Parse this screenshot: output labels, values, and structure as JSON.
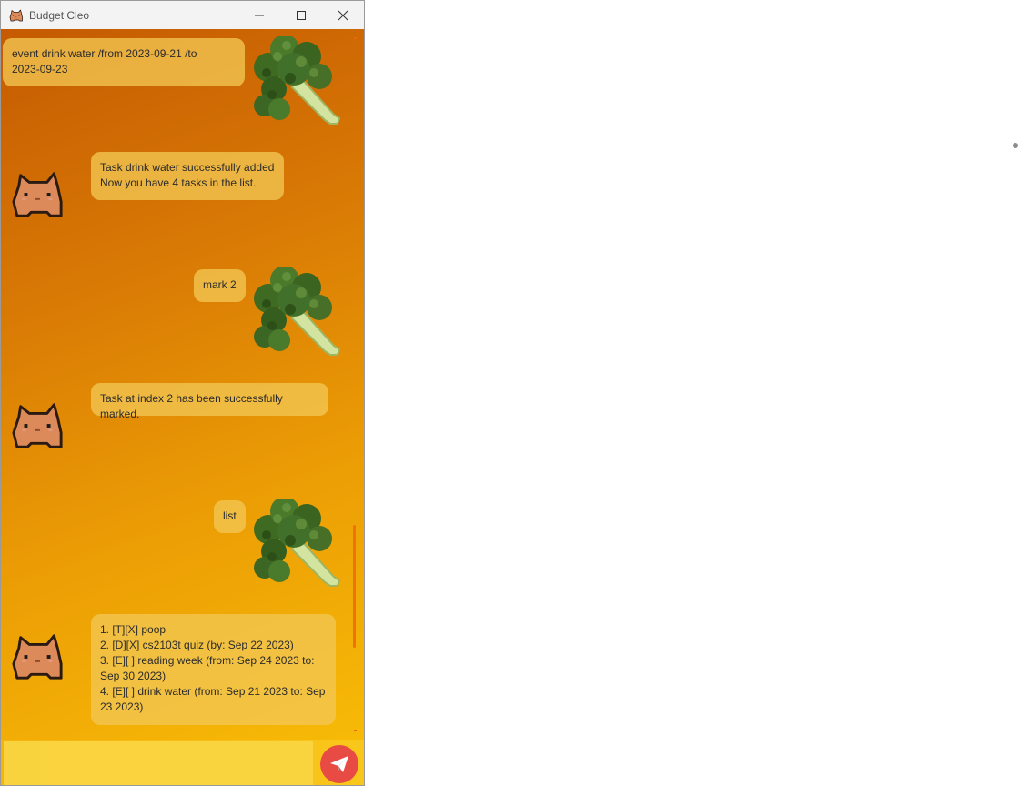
{
  "window": {
    "title": "Budget Cleo",
    "icons": {
      "app": "cat-app-icon",
      "minimize": "minimize-icon",
      "maximize": "maximize-icon",
      "close": "close-icon"
    }
  },
  "messages": [
    {
      "sender": "user",
      "text": "event drink water /from 2023-09-21 /to\n2023-09-23",
      "avatar": "broccoli-avatar"
    },
    {
      "sender": "bot",
      "text": "Task drink water successfully added\nNow you have 4 tasks in the list.",
      "avatar": "cat-avatar"
    },
    {
      "sender": "user",
      "text": "mark 2",
      "avatar": "broccoli-avatar"
    },
    {
      "sender": "bot",
      "text": "Task at index 2 has been successfully marked.",
      "avatar": "cat-avatar"
    },
    {
      "sender": "user",
      "text": "list",
      "avatar": "broccoli-avatar"
    },
    {
      "sender": "bot",
      "text": "1. [T][X] poop\n2. [D][X] cs2103t quiz (by: Sep 22 2023)\n3. [E][ ] reading week (from: Sep 24 2023 to:\nSep 30 2023)\n4. [E][ ] drink water (from: Sep 21 2023 to: Sep\n23 2023)",
      "avatar": "cat-avatar"
    }
  ],
  "input": {
    "value": "",
    "placeholder": ""
  },
  "send_button": {
    "icon": "paper-plane-icon"
  },
  "colors": {
    "gradient_top": "#c55a02",
    "gradient_bottom": "#f7ba06",
    "bubble": "#f2c652",
    "send_button": "#e84a44",
    "scrollbar": "#f2720a"
  }
}
